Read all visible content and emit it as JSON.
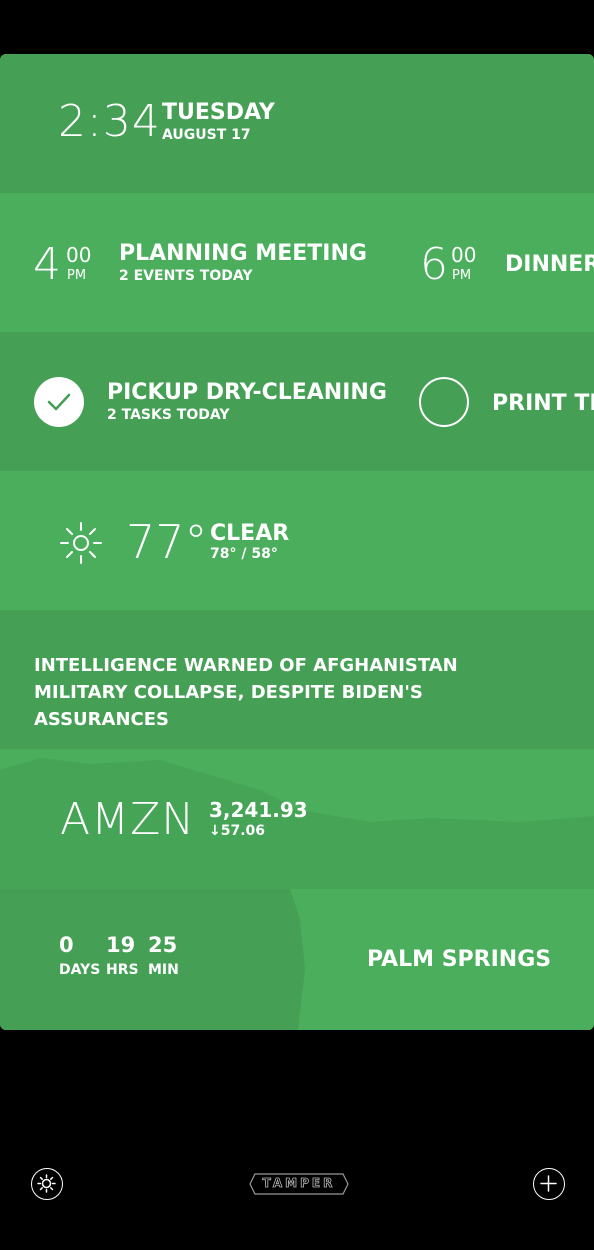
{
  "clock": {
    "time": "2:34",
    "day": "TUESDAY",
    "date": "AUGUST 17"
  },
  "events": {
    "items": [
      {
        "hour": "4",
        "minute": "00",
        "ampm": "PM",
        "title": "PLANNING MEETING"
      },
      {
        "hour": "6",
        "minute": "00",
        "ampm": "PM",
        "title": "DINNER"
      }
    ],
    "summary": "2 EVENTS TODAY"
  },
  "tasks": {
    "items": [
      {
        "title": "PICKUP DRY-CLEANING",
        "done": true
      },
      {
        "title": "PRINT TIC",
        "done": false
      }
    ],
    "summary": "2 TASKS TODAY"
  },
  "weather": {
    "temp": "77°",
    "condition": "CLEAR",
    "range": "78° / 58°",
    "icon": "sun-icon"
  },
  "news": {
    "headline": "INTELLIGENCE WARNED OF AFGHANISTAN MILITARY COLLAPSE, DESPITE BIDEN'S ASSURANCES"
  },
  "stock": {
    "ticker": "AMZN",
    "price": "3,241.93",
    "change": "↓57.06"
  },
  "countdown": {
    "days": "0",
    "days_label": "DAYS",
    "hours": "19",
    "hours_label": "HRS",
    "minutes": "25",
    "minutes_label": "MIN",
    "destination": "PALM SPRINGS"
  },
  "bottom_bar": {
    "logo": "TAMPER",
    "settings_icon": "gear-icon",
    "add_icon": "plus-icon"
  },
  "colors": {
    "background": "#000000",
    "card_dark": "#45a055",
    "card_light": "#4aae5c"
  }
}
